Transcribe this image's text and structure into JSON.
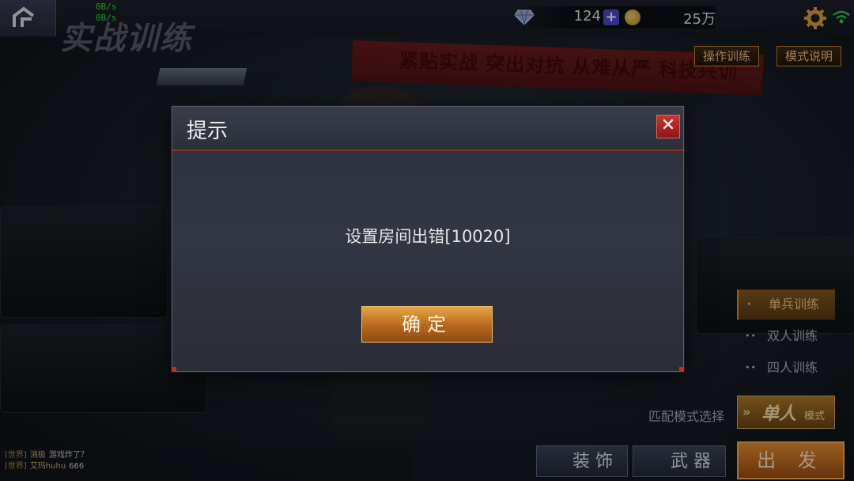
{
  "net_stats": {
    "upload": "0B/s",
    "download": "0B/s"
  },
  "page_title": "实战训练",
  "resources": {
    "gem_count": "124",
    "add_label": "+",
    "coin_count": "25万"
  },
  "banner_text": "紧贴实战 突出对抗 从难从严 科技兴训",
  "top_buttons": {
    "operation_training": "操作训练",
    "mode_description": "模式说明"
  },
  "mode_list": [
    {
      "label": "单兵训练",
      "dots": "•",
      "active": true
    },
    {
      "label": "双人训练",
      "dots": "••",
      "active": false
    },
    {
      "label": "四人训练",
      "dots": "••",
      "active": false
    }
  ],
  "match_mode": {
    "label": "匹配模式选择",
    "value": "单人",
    "suffix": "模式",
    "chevron": "»"
  },
  "chat": [
    {
      "channel": "[世界]",
      "user": "消极",
      "message": "游戏炸了？"
    },
    {
      "channel": "[世界]",
      "user": "艾玛huhu",
      "message": "666"
    }
  ],
  "bottom_buttons": {
    "decoration": "装 饰",
    "weapon": "武 器",
    "go": "出 发"
  },
  "modal": {
    "title": "提示",
    "close_label": "✕",
    "message": "设置房间出错[10020]",
    "confirm_label": "确定"
  },
  "colors": {
    "accent": "#c98a2a",
    "alert_red": "#d0322a",
    "net_green": "#31e03a"
  }
}
